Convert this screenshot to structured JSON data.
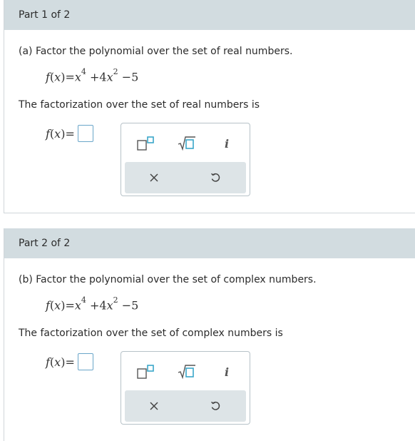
{
  "part1": {
    "header": "Part 1 of 2",
    "question": "(a) Factor the polynomial over the set of real numbers.",
    "poly": {
      "f": "f",
      "x": "x",
      "open": "(",
      "close": ")",
      "eq": "=",
      "t1": "x",
      "e1": "4",
      "op1": "+4",
      "t2": "x",
      "e2": "2",
      "op2": "−5"
    },
    "prompt": "The factorization over the set of real numbers is",
    "answer_label": {
      "f": "f",
      "x": "x",
      "open": "(",
      "close": ")",
      "eq": "="
    }
  },
  "part2": {
    "header": "Part 2 of 2",
    "question": "(b) Factor the polynomial over the set of complex numbers.",
    "poly": {
      "f": "f",
      "x": "x",
      "open": "(",
      "close": ")",
      "eq": "=",
      "t1": "x",
      "e1": "4",
      "op1": "+4",
      "t2": "x",
      "e2": "2",
      "op2": "−5"
    },
    "prompt": "The factorization over the set of complex numbers is",
    "answer_label": {
      "f": "f",
      "x": "x",
      "open": "(",
      "close": ")",
      "eq": "="
    }
  },
  "palette": {
    "exponent": "exponent-icon",
    "sqrt": "sqrt-icon",
    "imag_label": "i",
    "clear": "close-icon",
    "undo": "undo-icon"
  },
  "colors": {
    "header_bg": "#d2dce0",
    "accent": "#3aa7c9",
    "palette_row_bg": "#dde4e7"
  }
}
